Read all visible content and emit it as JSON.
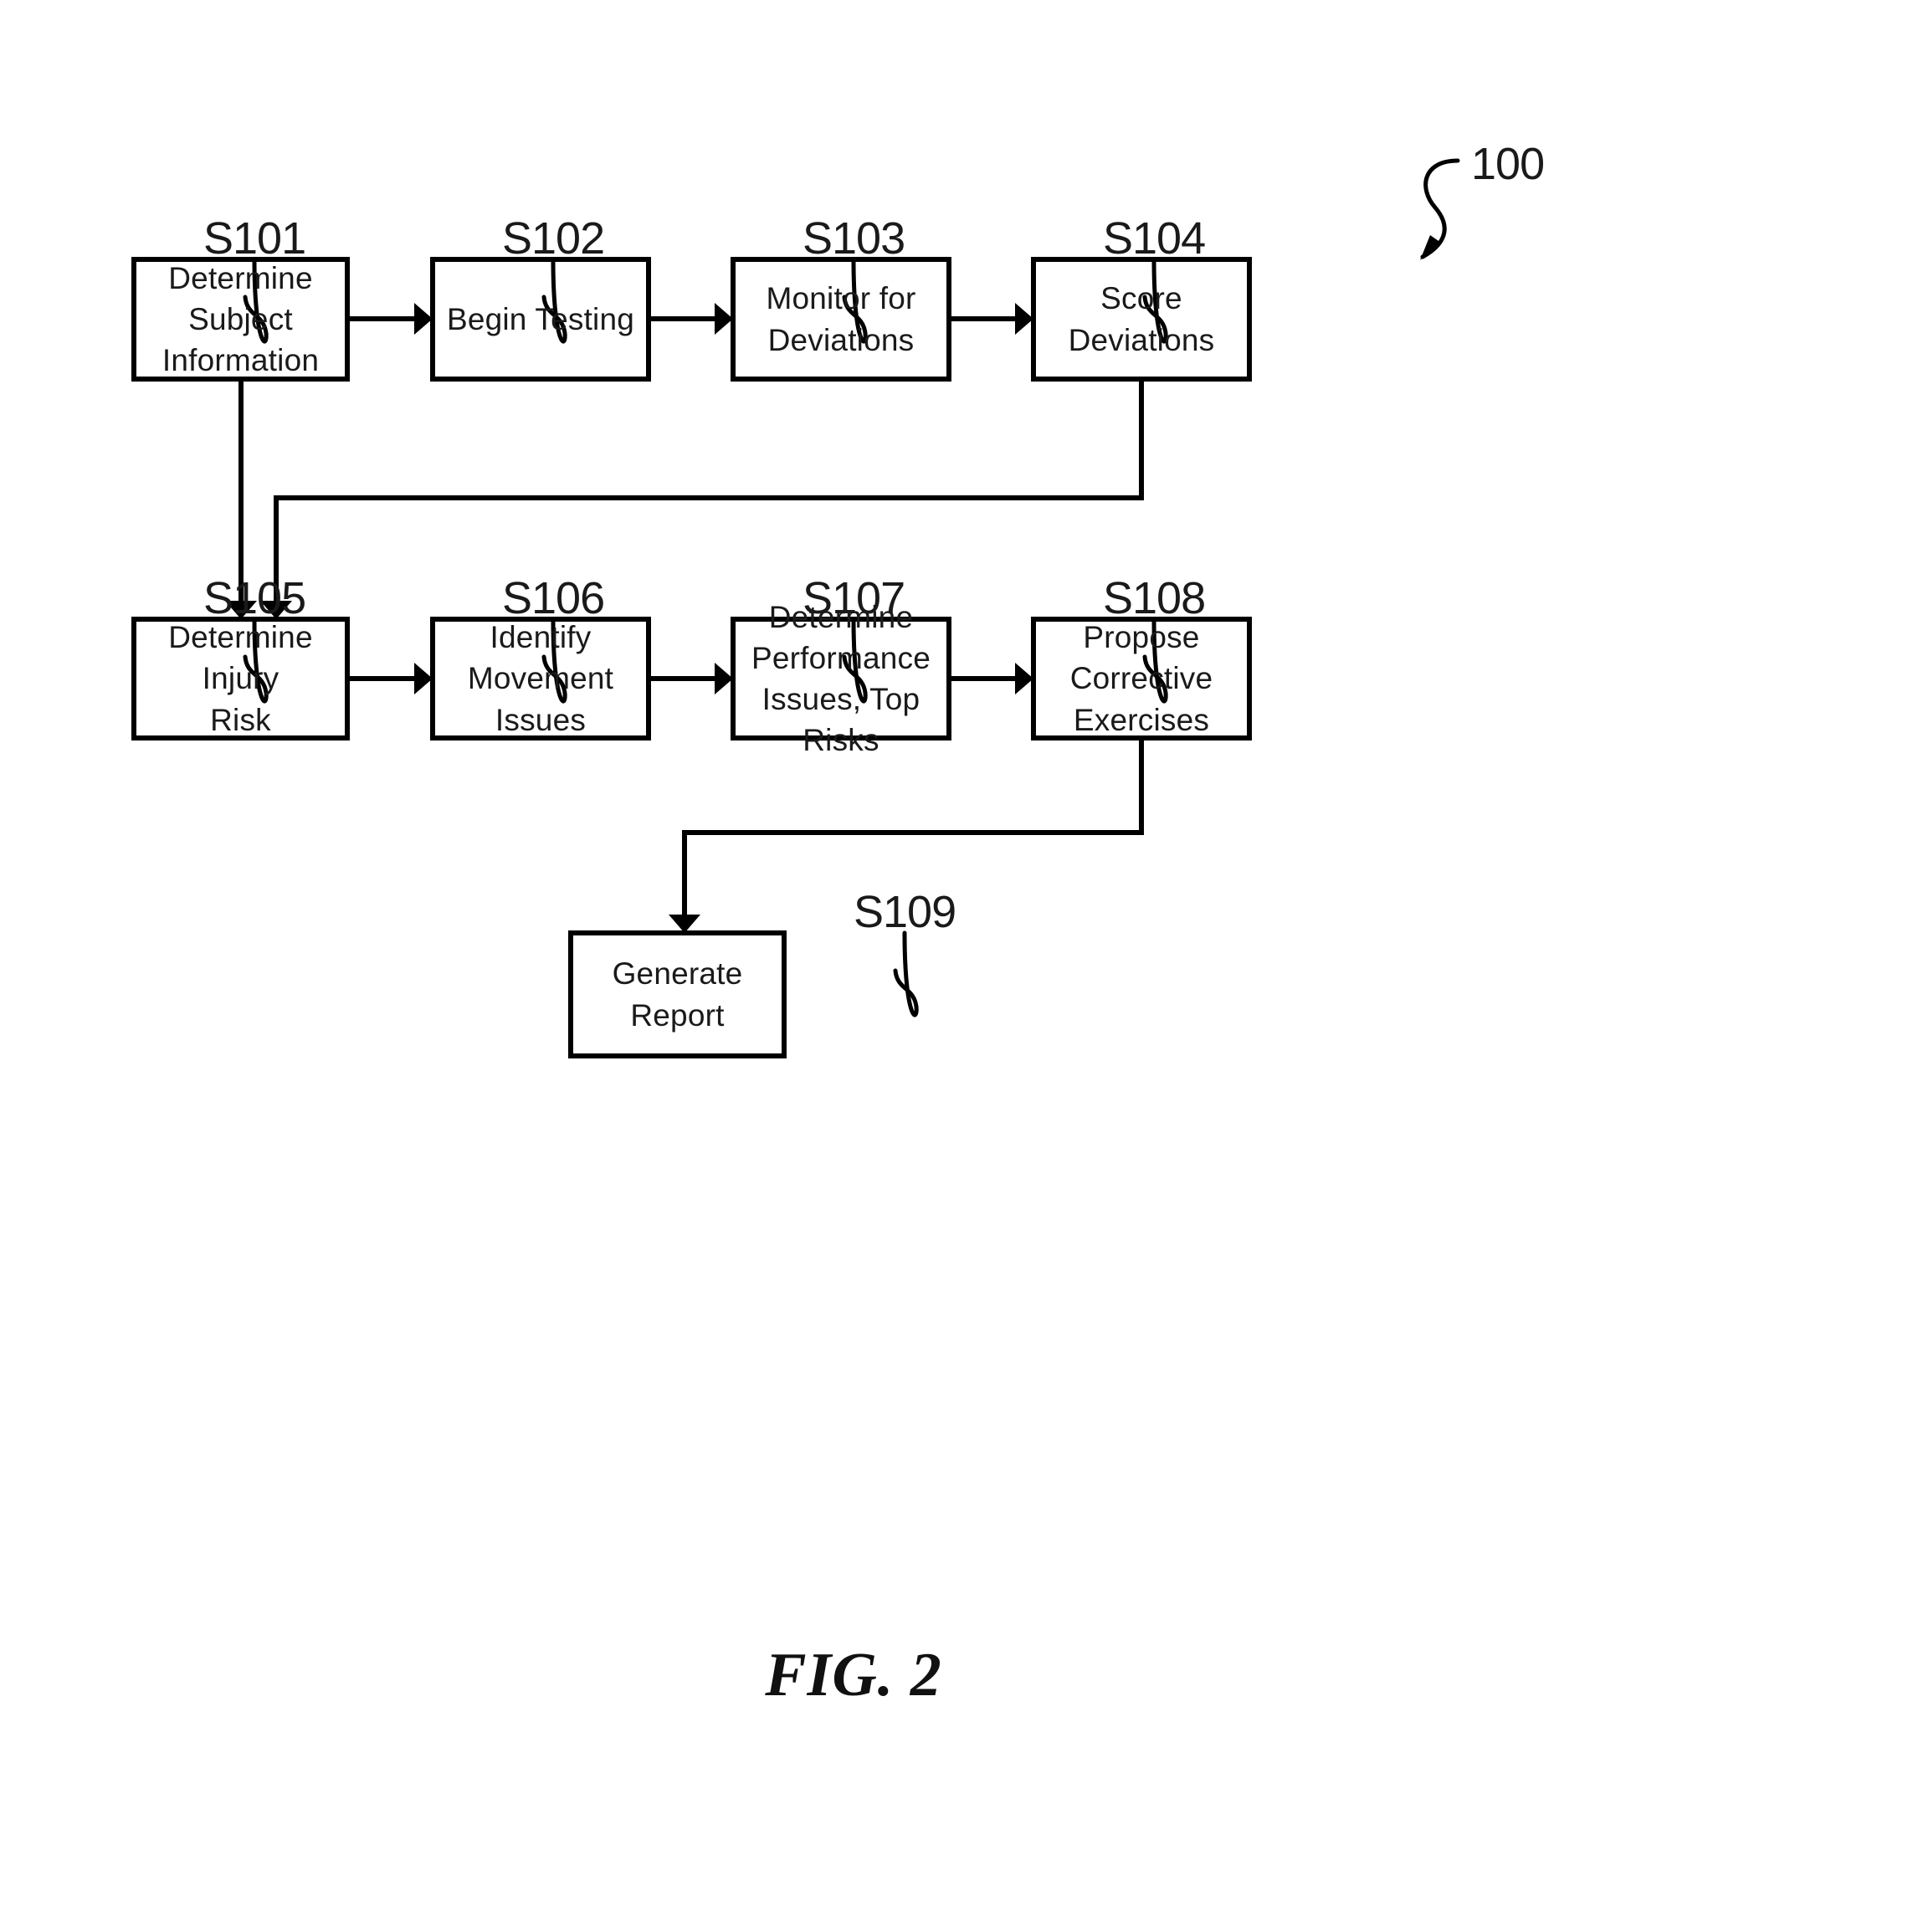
{
  "figure": {
    "caption": "FIG. 2",
    "reference_numeral": "100",
    "diagram_type": "flowchart",
    "background_color": "#ffffff",
    "line_color": "#000000"
  },
  "steps": [
    {
      "tag": "S101",
      "label": "Determine\nSubject\nInformation",
      "row": 1,
      "column": 1
    },
    {
      "tag": "S102",
      "label": "Begin Testing",
      "row": 1,
      "column": 2
    },
    {
      "tag": "S103",
      "label": "Monitor for\nDeviations",
      "row": 1,
      "column": 3
    },
    {
      "tag": "S104",
      "label": "Score Deviations",
      "row": 1,
      "column": 4
    },
    {
      "tag": "S105",
      "label": "Determine Injury\nRisk",
      "row": 2,
      "column": 1
    },
    {
      "tag": "S106",
      "label": "Identify\nMovement Issues",
      "row": 2,
      "column": 2
    },
    {
      "tag": "S107",
      "label": "Determine\nPerformance\nIssues, Top Risks",
      "row": 2,
      "column": 3
    },
    {
      "tag": "S108",
      "label": "Propose\nCorrective\nExercises",
      "row": 2,
      "column": 4
    },
    {
      "tag": "S109",
      "label": "Generate Report",
      "row": 3,
      "column": 2
    }
  ],
  "connections": [
    {
      "from": "S101",
      "to": "S102",
      "kind": "straight-right"
    },
    {
      "from": "S102",
      "to": "S103",
      "kind": "straight-right"
    },
    {
      "from": "S103",
      "to": "S104",
      "kind": "straight-right"
    },
    {
      "from": "S104",
      "to": "S105",
      "kind": "wrap-down-left"
    },
    {
      "from": "S101",
      "to": "S105",
      "kind": "down"
    },
    {
      "from": "S105",
      "to": "S106",
      "kind": "straight-right"
    },
    {
      "from": "S106",
      "to": "S107",
      "kind": "straight-right"
    },
    {
      "from": "S107",
      "to": "S108",
      "kind": "straight-right"
    },
    {
      "from": "S108",
      "to": "S109",
      "kind": "wrap-down-left"
    }
  ]
}
